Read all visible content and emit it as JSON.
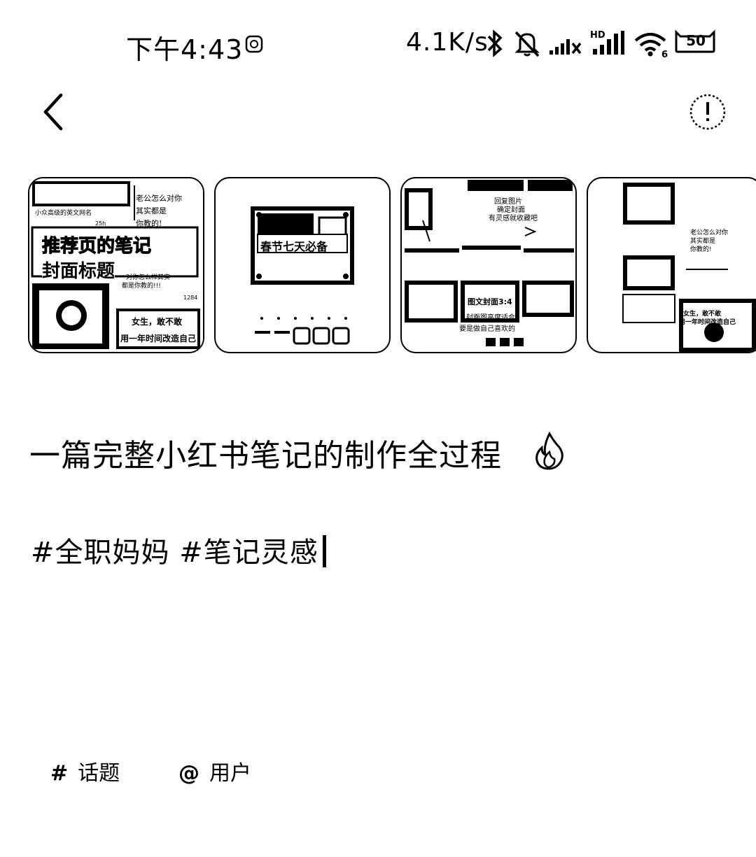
{
  "status_bar": {
    "time": "下午4:43",
    "net_speed": "4.1K/s",
    "battery": "50",
    "wifi_label": "6",
    "signal_hd_label": "HD"
  },
  "images": {
    "thumb1": {
      "lines": [
        "老公怎么对你",
        "其实都是",
        "你教的!",
        "小众高级的英文网名",
        "推荐页的笔记",
        "封面标题",
        "对你怎么样其实",
        "都是你教的!!!",
        "女生，敢不敢",
        "用一年时间改造自己",
        "25h",
        "1284"
      ]
    },
    "thumb2": {
      "lines": [
        "春节七天必备"
      ]
    },
    "thumb3": {
      "lines": [
        "回复图片",
        "确定封面",
        "有灵感就收藏吧",
        "图文封面3:4",
        "封面图高度适合",
        "要是做自己喜欢的"
      ]
    },
    "thumb4": {
      "lines": [
        "老公怎么对你",
        "其实都是",
        "你教的!",
        "女生，敢不敢",
        "用一年时间改造自己"
      ]
    }
  },
  "note": {
    "title": "一篇完整小红书笔记的制作全过程",
    "hashtags": "#全职妈妈 #笔记灵感"
  },
  "bottom_actions": {
    "topic_symbol": "#",
    "topic_label": "话题",
    "user_symbol": "@",
    "user_label": "用户"
  },
  "icons": [
    "back-arrow-icon",
    "info-icon",
    "bluetooth-icon",
    "mute-bell-icon",
    "signal-icon",
    "wifi-icon",
    "battery-icon",
    "flame-icon"
  ]
}
